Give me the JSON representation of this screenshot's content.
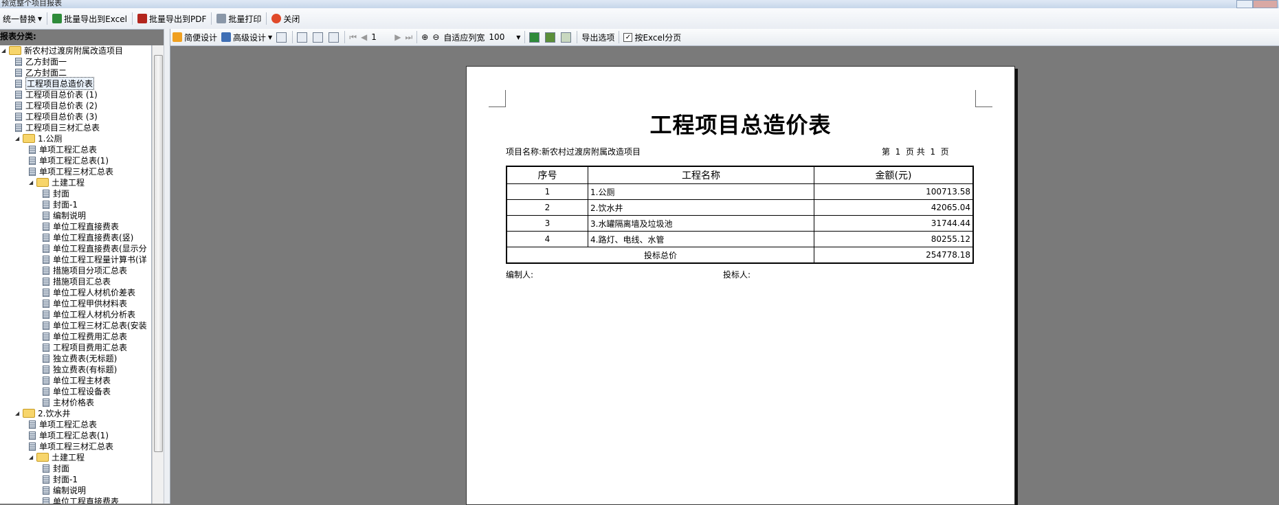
{
  "window": {
    "title": "预览整个项目报表"
  },
  "top_toolbar": {
    "replace_label": "统一替换",
    "export_excel": "批量导出到Excel",
    "export_pdf": "批量导出到PDF",
    "batch_print": "批量打印",
    "close": "关闭"
  },
  "left_panel": {
    "heading": "报表分类:"
  },
  "tree": [
    {
      "label": "新农村过渡房附属改造项目",
      "level": 0,
      "type": "folder",
      "expander": "◢"
    },
    {
      "label": "乙方封面一",
      "level": 1,
      "type": "doc"
    },
    {
      "label": "乙方封面二",
      "level": 1,
      "type": "doc"
    },
    {
      "label": "工程项目总造价表",
      "level": 1,
      "type": "doc",
      "selected": true
    },
    {
      "label": "工程项目总价表 (1)",
      "level": 1,
      "type": "doc"
    },
    {
      "label": "工程项目总价表 (2)",
      "level": 1,
      "type": "doc"
    },
    {
      "label": "工程项目总价表 (3)",
      "level": 1,
      "type": "doc"
    },
    {
      "label": "工程项目三材汇总表",
      "level": 1,
      "type": "doc"
    },
    {
      "label": "1.公厕",
      "level": 1,
      "type": "folder",
      "expander": "◢"
    },
    {
      "label": "单项工程汇总表",
      "level": 2,
      "type": "doc"
    },
    {
      "label": "单项工程汇总表(1)",
      "level": 2,
      "type": "doc"
    },
    {
      "label": "单项工程三材汇总表",
      "level": 2,
      "type": "doc"
    },
    {
      "label": "土建工程",
      "level": 2,
      "type": "folder",
      "expander": "◢"
    },
    {
      "label": "封面",
      "level": 3,
      "type": "doc"
    },
    {
      "label": "封面-1",
      "level": 3,
      "type": "doc"
    },
    {
      "label": "编制说明",
      "level": 3,
      "type": "doc"
    },
    {
      "label": "单位工程直接费表",
      "level": 3,
      "type": "doc"
    },
    {
      "label": "单位工程直接费表(竖)",
      "level": 3,
      "type": "doc"
    },
    {
      "label": "单位工程直接费表(显示分",
      "level": 3,
      "type": "doc"
    },
    {
      "label": "单位工程工程量计算书(详",
      "level": 3,
      "type": "doc"
    },
    {
      "label": "措施项目分项汇总表",
      "level": 3,
      "type": "doc"
    },
    {
      "label": "措施项目汇总表",
      "level": 3,
      "type": "doc"
    },
    {
      "label": "单位工程人材机价差表",
      "level": 3,
      "type": "doc"
    },
    {
      "label": "单位工程甲供材料表",
      "level": 3,
      "type": "doc"
    },
    {
      "label": "单位工程人材机分析表",
      "level": 3,
      "type": "doc"
    },
    {
      "label": "单位工程三材汇总表(安装",
      "level": 3,
      "type": "doc"
    },
    {
      "label": "单位工程费用汇总表",
      "level": 3,
      "type": "doc"
    },
    {
      "label": "工程项目费用汇总表",
      "level": 3,
      "type": "doc"
    },
    {
      "label": "独立费表(无标题)",
      "level": 3,
      "type": "doc"
    },
    {
      "label": "独立费表(有标题)",
      "level": 3,
      "type": "doc"
    },
    {
      "label": "单位工程主材表",
      "level": 3,
      "type": "doc"
    },
    {
      "label": "单位工程设备表",
      "level": 3,
      "type": "doc"
    },
    {
      "label": "主材价格表",
      "level": 3,
      "type": "doc"
    },
    {
      "label": "2.饮水井",
      "level": 1,
      "type": "folder",
      "expander": "◢"
    },
    {
      "label": "单项工程汇总表",
      "level": 2,
      "type": "doc"
    },
    {
      "label": "单项工程汇总表(1)",
      "level": 2,
      "type": "doc"
    },
    {
      "label": "单项工程三材汇总表",
      "level": 2,
      "type": "doc"
    },
    {
      "label": "土建工程",
      "level": 2,
      "type": "folder",
      "expander": "◢"
    },
    {
      "label": "封面",
      "level": 3,
      "type": "doc"
    },
    {
      "label": "封面-1",
      "level": 3,
      "type": "doc"
    },
    {
      "label": "编制说明",
      "level": 3,
      "type": "doc"
    },
    {
      "label": "单位工程直接费表",
      "level": 3,
      "type": "doc"
    }
  ],
  "report_toolbar": {
    "simple_design": "简便设计",
    "advanced_design": "高级设计",
    "page_value": "1",
    "fit_width": "自适应列宽",
    "zoom": "100",
    "export_options": "导出选项",
    "excel_paging": "按Excel分页",
    "excel_paging_checked": true
  },
  "report": {
    "title": "工程项目总造价表",
    "project_label": "项目名称:",
    "project_name": "新农村过渡房附属改造项目",
    "page_info": "第  1  页 共  1  页",
    "headers": [
      "序号",
      "工程名称",
      "金额(元)"
    ],
    "rows": [
      {
        "no": "1",
        "name": "1.公厕",
        "amount": "100713.58"
      },
      {
        "no": "2",
        "name": "2.饮水井",
        "amount": "42065.04"
      },
      {
        "no": "3",
        "name": "3.水罐隔离墙及垃圾池",
        "amount": "31744.44"
      },
      {
        "no": "4",
        "name": "4.路灯、电线、水管",
        "amount": "80255.12"
      }
    ],
    "total_label": "投标总价",
    "total_amount": "254778.18",
    "prepared_by": "编制人:",
    "bidder": "投标人:"
  }
}
